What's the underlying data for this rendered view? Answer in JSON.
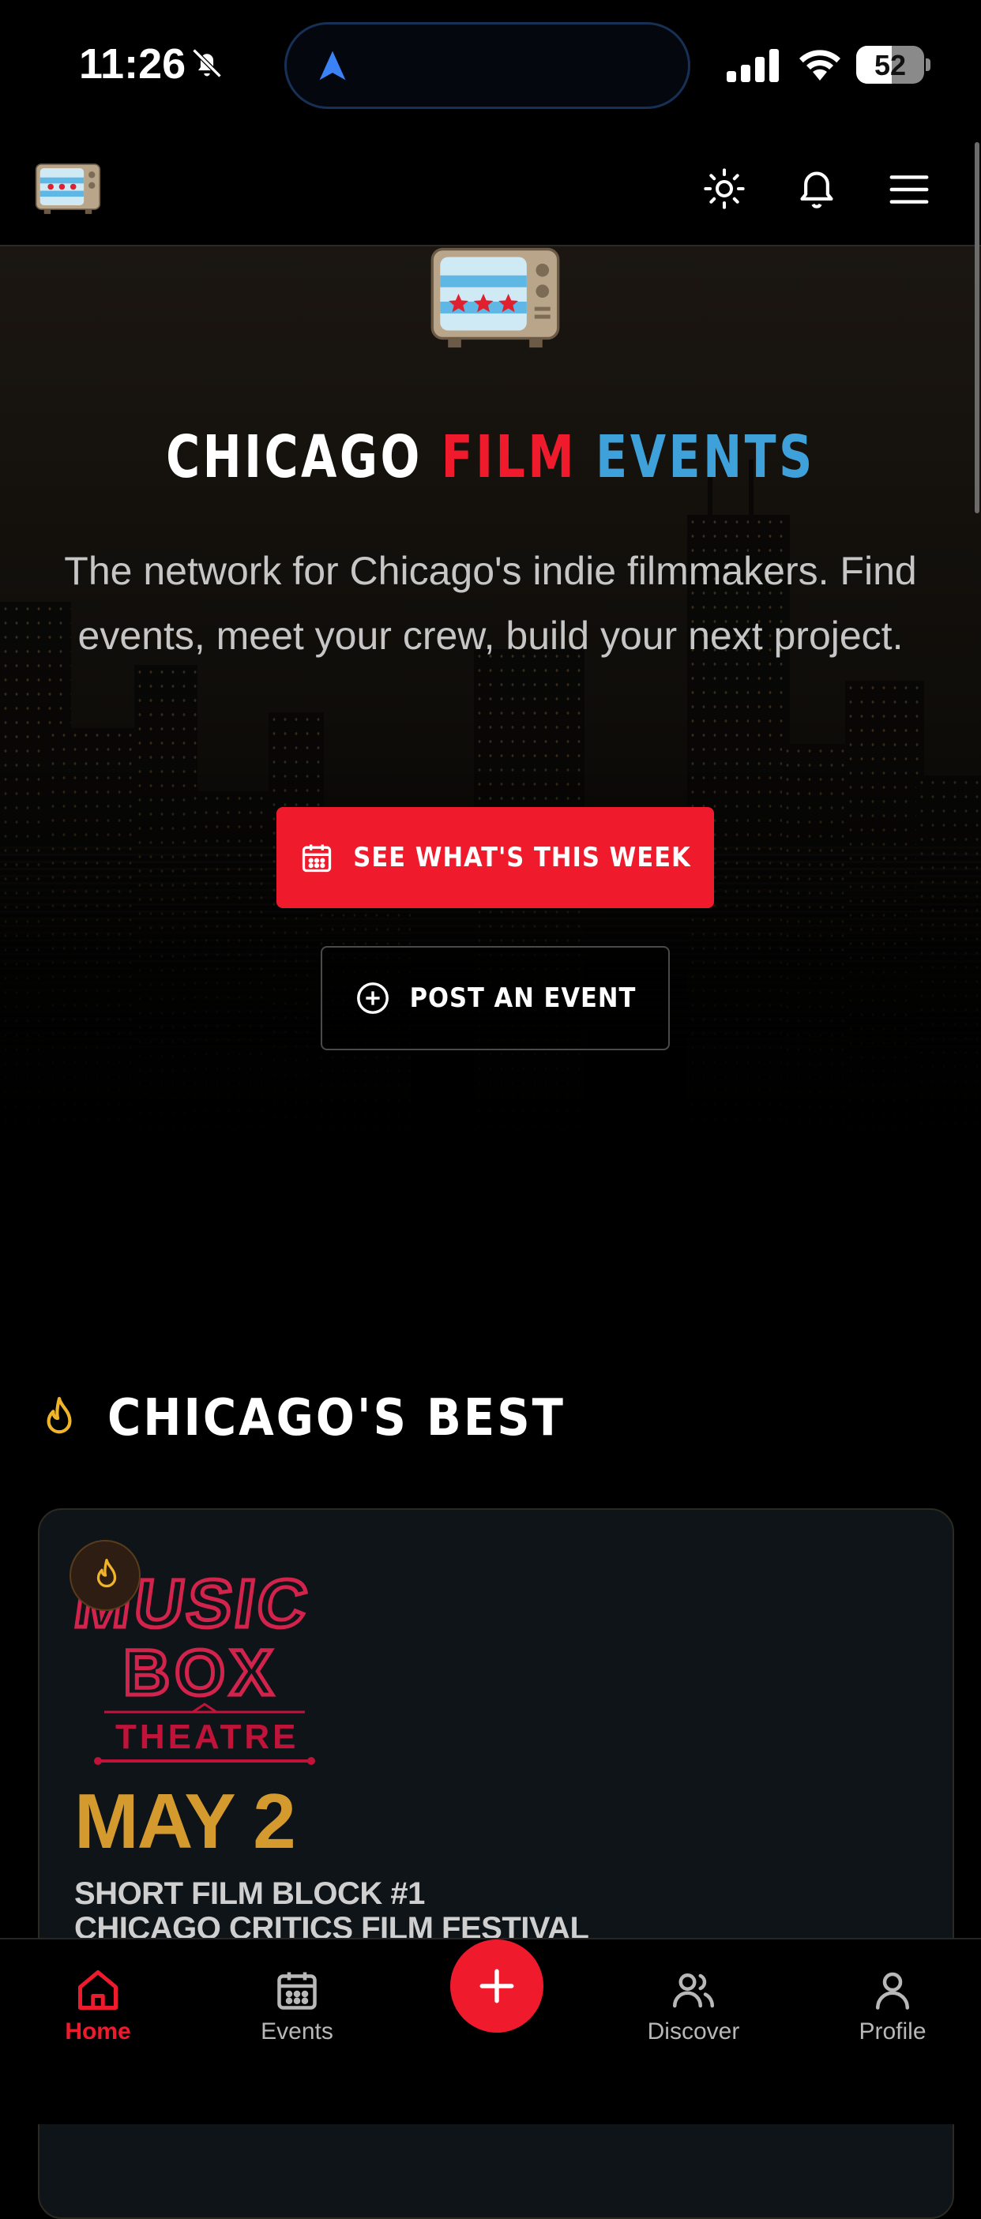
{
  "status_bar": {
    "time": "11:26",
    "battery": "52",
    "battery_level": 0.52
  },
  "hero": {
    "title_w1": "CHICAGO",
    "title_w2": "FILM",
    "title_w3": "EVENTS",
    "tagline": "The network for Chicago's indie filmmakers. Find events, meet your crew, build your next project.",
    "primary_cta": "SEE WHAT'S THIS WEEK",
    "secondary_cta": "POST AN EVENT"
  },
  "best": {
    "title": "CHICAGO'S BEST",
    "card": {
      "venue_logo_text": [
        "MUSIC",
        "BOX",
        "THEATRE"
      ],
      "date": "MAY 2",
      "line1": "SHORT FILM BLOCK #1",
      "line2": "CHICAGO CRITICS FILM FESTIVAL"
    }
  },
  "tabs": {
    "home": "Home",
    "events": "Events",
    "discover": "Discover",
    "profile": "Profile",
    "active": "home"
  },
  "colors": {
    "accent_red": "#ef1b2d",
    "accent_blue": "#3ea1da",
    "date_gold": "#d59a2e",
    "background": "#000000"
  },
  "icons": [
    "mute-icon",
    "location-arrow-icon",
    "signal-icon",
    "wifi-icon",
    "sun-icon",
    "bell-icon",
    "menu-icon",
    "calendar-icon",
    "plus-circle-icon",
    "flame-icon",
    "home-icon",
    "people-icon",
    "person-icon",
    "plus-icon"
  ]
}
